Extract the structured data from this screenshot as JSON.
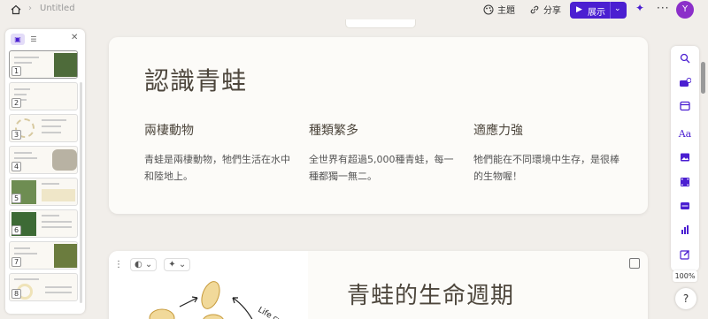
{
  "header": {
    "doc_title": "Untitled",
    "theme_label": "主題",
    "share_label": "分享",
    "present_label": "展示",
    "avatar_initial": "Y"
  },
  "panel": {
    "slides": [
      {
        "num": "1"
      },
      {
        "num": "2"
      },
      {
        "num": "3"
      },
      {
        "num": "4"
      },
      {
        "num": "5"
      },
      {
        "num": "6"
      },
      {
        "num": "7"
      },
      {
        "num": "8"
      }
    ]
  },
  "slide1": {
    "title": "認識青蛙",
    "columns": [
      {
        "heading": "兩棲動物",
        "body": "青蛙是兩棲動物，牠們生活在水中和陸地上。"
      },
      {
        "heading": "種類繁多",
        "body": "全世界有超過5,000種青蛙，每一種都獨一無二。"
      },
      {
        "heading": "適應力強",
        "body": "牠們能在不同環境中生存，是很棒的生物喔！"
      }
    ]
  },
  "slide2": {
    "title": "青蛙的生命週期",
    "diagram_label": "Life cycle"
  },
  "zoom": "100%",
  "help": "?",
  "colors": {
    "accent": "#4b1fd1",
    "avatar": "#8b2fc9",
    "title_text": "#4d463c"
  }
}
